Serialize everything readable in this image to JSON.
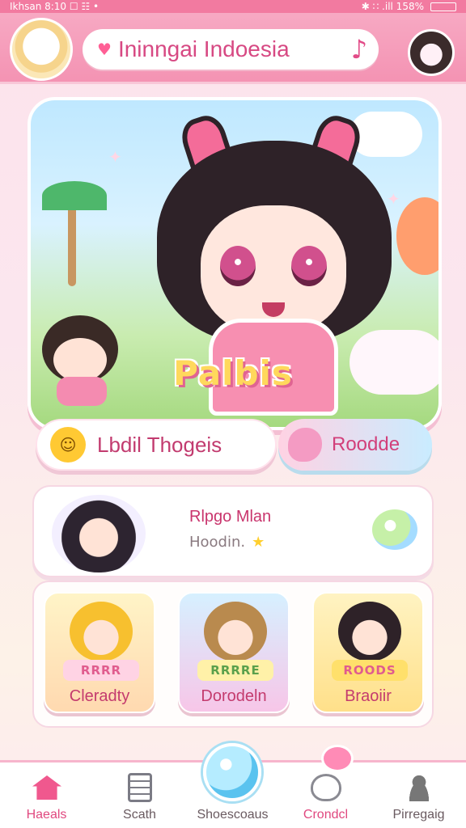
{
  "status_bar": {
    "left_text": "Ikhsan 8:10 ☐ ☷ •",
    "right_text": "✱ ∷ .ill 158%"
  },
  "header": {
    "title": "Ininngai Indoesia",
    "heart_icon": "heart-icon",
    "music_icon": "music-note-icon"
  },
  "hero": {
    "logo_text": "Palbis"
  },
  "actions": {
    "primary_label": "Lbdil Thogeis",
    "secondary_label": "Roodde"
  },
  "profile": {
    "name": "Rlpgo Mlan",
    "subtitle": "Hoodin."
  },
  "categories": [
    {
      "badge": "RRRR",
      "label": "Cleradty"
    },
    {
      "badge": "RRRRE",
      "label": "Dorodeln"
    },
    {
      "badge": "ROODS",
      "label": "Braoiir"
    }
  ],
  "nav": {
    "items": [
      {
        "label": "Haeals",
        "icon": "home-icon",
        "active": true
      },
      {
        "label": "Scath",
        "icon": "document-icon",
        "active": false
      },
      {
        "label": "Shoescoaus",
        "icon": "bubble-icon",
        "active": false
      },
      {
        "label": "Crondcl",
        "icon": "chat-icon",
        "active": true
      },
      {
        "label": "Pirregaig",
        "icon": "person-icon",
        "active": false
      }
    ]
  },
  "colors": {
    "accent": "#f27aa0",
    "title_text": "#d74983",
    "active_nav": "#e0487f"
  }
}
